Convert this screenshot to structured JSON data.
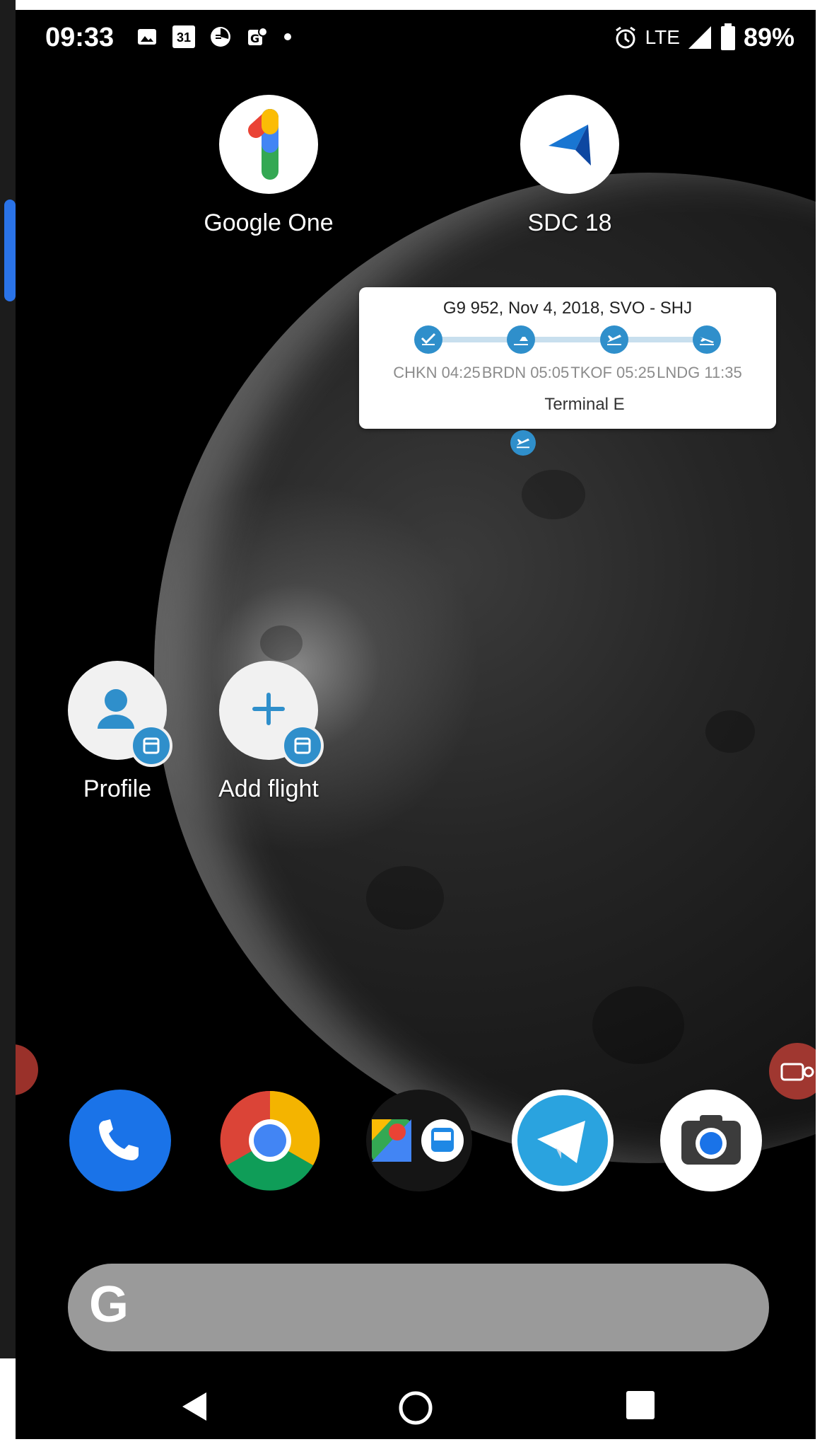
{
  "status_bar": {
    "time": "09:33",
    "calendar_day": "31",
    "network": "LTE",
    "battery": "89%"
  },
  "home_apps": [
    {
      "label": "Google One",
      "icon": "google-one-icon"
    },
    {
      "label": "SDC 18",
      "icon": "sdc-app-icon"
    }
  ],
  "flight_widget": {
    "title": "G9 952, Nov 4, 2018, SVO - SHJ",
    "times": [
      "CHKN 04:25",
      "BRDN 05:05",
      "TKOF 05:25",
      "LNDG 11:35"
    ],
    "terminal": "Terminal E"
  },
  "shortcuts": [
    {
      "label": "Profile",
      "icon": "person-icon"
    },
    {
      "label": "Add flight",
      "icon": "plus-icon"
    }
  ],
  "dock": [
    "phone-icon",
    "chrome-icon",
    "maps-folder-icon",
    "telegram-icon",
    "camera-icon"
  ],
  "search": {
    "logo": "G"
  },
  "colors": {
    "accent_blue": "#2f8fcb",
    "phone_blue": "#1a73e8",
    "telegram_blue": "#2aa3df"
  }
}
